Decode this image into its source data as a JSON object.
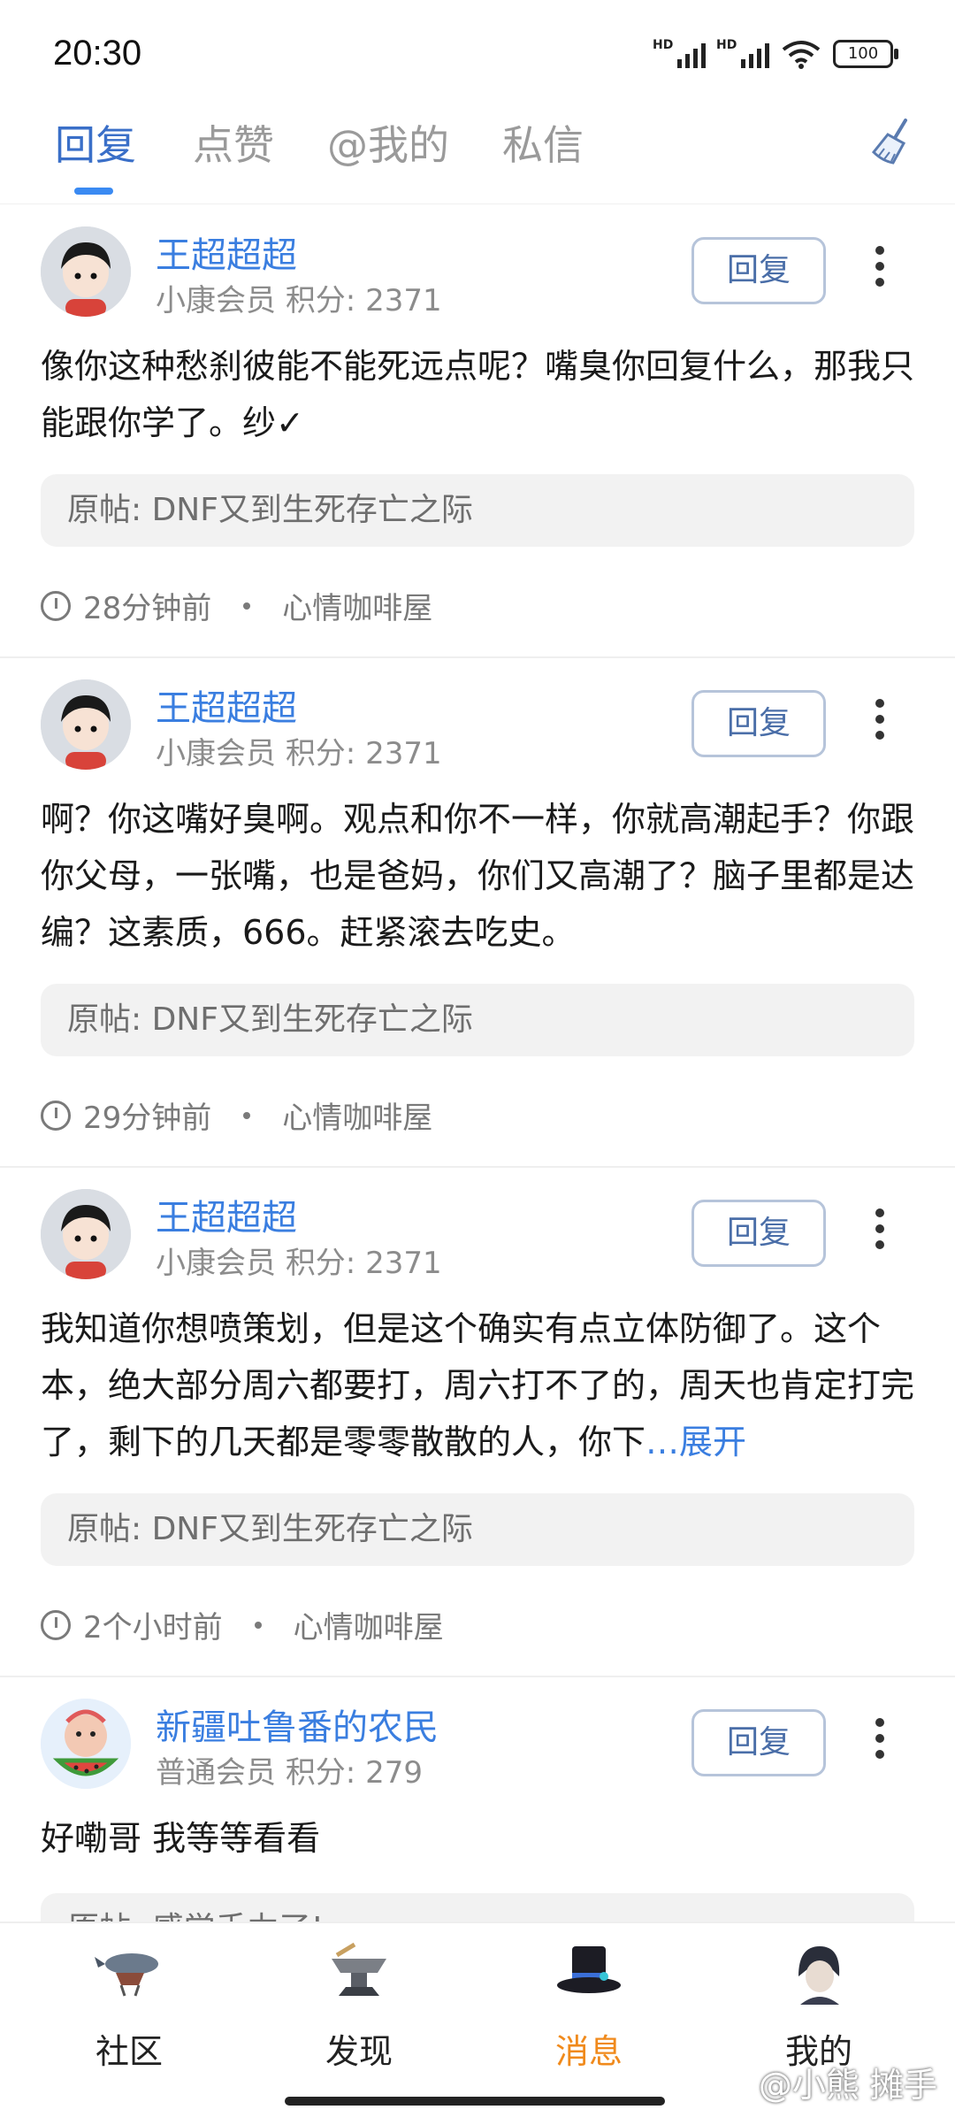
{
  "status_bar": {
    "time": "20:30",
    "battery": "100",
    "hd": "HD"
  },
  "tabs": [
    {
      "label": "回复",
      "active": true
    },
    {
      "label": "点赞",
      "active": false
    },
    {
      "label": "@我的",
      "active": false
    },
    {
      "label": "私信",
      "active": false
    }
  ],
  "clear_icon": "broom-icon",
  "posts": [
    {
      "username": "王超超超",
      "level": "小康会员",
      "points": "积分: 2371",
      "reply_label": "回复",
      "content": "像你这种愁刹彼能不能死远点呢？嘴臭你回复什么，那我只能跟你学了。纱✓",
      "original": "原帖:  DNF又到生死存亡之际",
      "time": "28分钟前",
      "forum": "心情咖啡屋"
    },
    {
      "username": "王超超超",
      "level": "小康会员",
      "points": "积分: 2371",
      "reply_label": "回复",
      "content": "啊？你这嘴好臭啊。观点和你不一样，你就高潮起手？你跟你父母，一张嘴，也是爸妈，你们又高潮了？脑子里都是达编？这素质，666。赶紧滚去吃史。",
      "original": "原帖:  DNF又到生死存亡之际",
      "time": "29分钟前",
      "forum": "心情咖啡屋"
    },
    {
      "username": "王超超超",
      "level": "小康会员",
      "points": "积分: 2371",
      "reply_label": "回复",
      "content": "我知道你想喷策划，但是这个确实有点立体防御了。这个本，绝大部分周六都要打，周六打不了的，周天也肯定打完了，剩下的几天都是零零散散的人，你下",
      "expand": "…展开",
      "original": "原帖:  DNF又到生死存亡之际",
      "time": "2个小时前",
      "forum": "心情咖啡屋"
    },
    {
      "username": "新疆吐鲁番的农民",
      "level": "普通会员",
      "points": "积分: 279",
      "reply_label": "回复",
      "content": "好嘞哥 我等等看看",
      "original": "原帖:  感觉手力了!"
    }
  ],
  "bottom_nav": [
    {
      "label": "社区",
      "icon": "airship-icon",
      "active": false
    },
    {
      "label": "发现",
      "icon": "anvil-icon",
      "active": false
    },
    {
      "label": "消息",
      "icon": "top-hat-icon",
      "active": true
    },
    {
      "label": "我的",
      "icon": "character-avatar-icon",
      "active": false
    }
  ],
  "watermark": "@小熊 摊手"
}
